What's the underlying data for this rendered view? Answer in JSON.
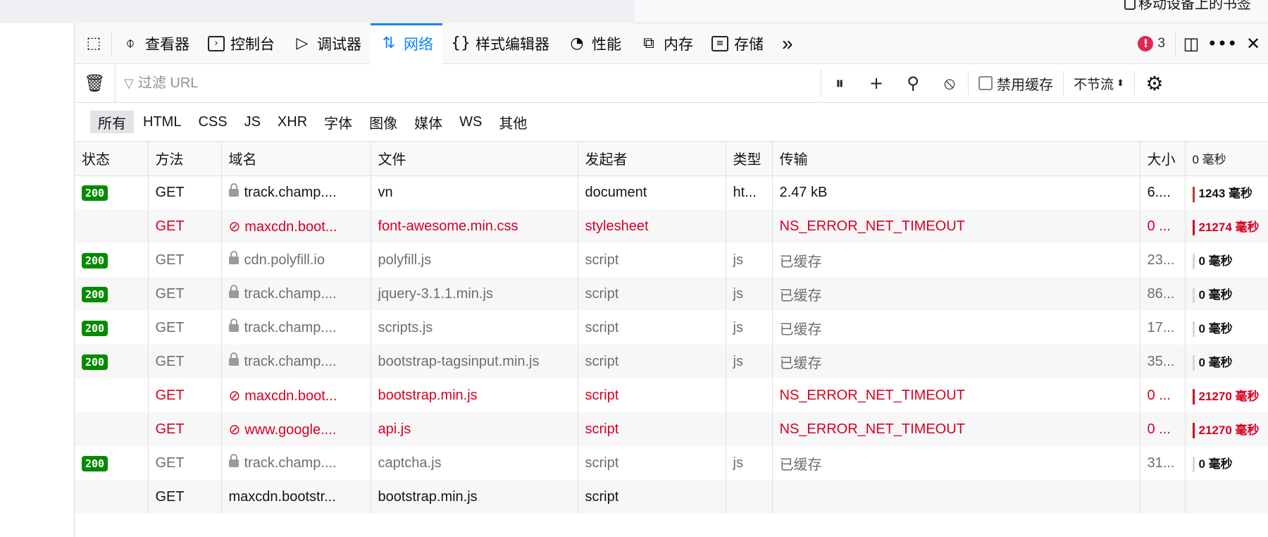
{
  "bookmark_bar": {
    "mobile_bookmarks": "移动设备上的书签"
  },
  "tabs": {
    "inspector": "查看器",
    "console": "控制台",
    "debugger": "调试器",
    "network": "网络",
    "style_editor": "样式编辑器",
    "performance": "性能",
    "memory": "内存",
    "storage": "存储",
    "more": "»",
    "error_count": "3"
  },
  "filterbar": {
    "placeholder": "过滤 URL",
    "disable_cache": "禁用缓存",
    "throttle": "不节流"
  },
  "type_filters": [
    "所有",
    "HTML",
    "CSS",
    "JS",
    "XHR",
    "字体",
    "图像",
    "媒体",
    "WS",
    "其他"
  ],
  "columns": {
    "status": "状态",
    "method": "方法",
    "domain": "域名",
    "file": "文件",
    "initiator": "发起者",
    "type": "类型",
    "transfer": "传输",
    "size": "大小",
    "waterfall": "0 毫秒"
  },
  "requests": [
    {
      "status": "200",
      "method": "GET",
      "domain": "track.champ....",
      "file": "vn",
      "initiator": "document",
      "type": "ht...",
      "transfer": "2.47 kB",
      "size": "6....",
      "time": "1243 毫秒"
    },
    {
      "status": "",
      "method": "GET",
      "domain": "maxcdn.boot...",
      "file": "font-awesome.min.css",
      "initiator": "stylesheet",
      "type": "",
      "transfer": "NS_ERROR_NET_TIMEOUT",
      "size": "0 ...",
      "time": "21274 毫秒"
    },
    {
      "status": "200",
      "method": "GET",
      "domain": "cdn.polyfill.io",
      "file": "polyfill.js",
      "initiator": "script",
      "type": "js",
      "transfer": "已缓存",
      "size": "23...",
      "time": "0 毫秒"
    },
    {
      "status": "200",
      "method": "GET",
      "domain": "track.champ....",
      "file": "jquery-3.1.1.min.js",
      "initiator": "script",
      "type": "js",
      "transfer": "已缓存",
      "size": "86...",
      "time": "0 毫秒"
    },
    {
      "status": "200",
      "method": "GET",
      "domain": "track.champ....",
      "file": "scripts.js",
      "initiator": "script",
      "type": "js",
      "transfer": "已缓存",
      "size": "17...",
      "time": "0 毫秒"
    },
    {
      "status": "200",
      "method": "GET",
      "domain": "track.champ....",
      "file": "bootstrap-tagsinput.min.js",
      "initiator": "script",
      "type": "js",
      "transfer": "已缓存",
      "size": "35...",
      "time": "0 毫秒"
    },
    {
      "status": "",
      "method": "GET",
      "domain": "maxcdn.boot...",
      "file": "bootstrap.min.js",
      "initiator": "script",
      "type": "",
      "transfer": "NS_ERROR_NET_TIMEOUT",
      "size": "0 ...",
      "time": "21270 毫秒"
    },
    {
      "status": "",
      "method": "GET",
      "domain": "www.google....",
      "file": "api.js",
      "initiator": "script",
      "type": "",
      "transfer": "NS_ERROR_NET_TIMEOUT",
      "size": "0 ...",
      "time": "21270 毫秒"
    },
    {
      "status": "200",
      "method": "GET",
      "domain": "track.champ....",
      "file": "captcha.js",
      "initiator": "script",
      "type": "js",
      "transfer": "已缓存",
      "size": "31...",
      "time": "0 毫秒"
    },
    {
      "status": "",
      "method": "GET",
      "domain": "maxcdn.bootstr...",
      "file": "bootstrap.min.js",
      "initiator": "script",
      "type": "",
      "transfer": "",
      "size": "",
      "time": ""
    }
  ],
  "footer": "...",
  "colors": {
    "accent": "#0a84ff",
    "error": "#d70022",
    "ok_badge": "#058b00"
  }
}
